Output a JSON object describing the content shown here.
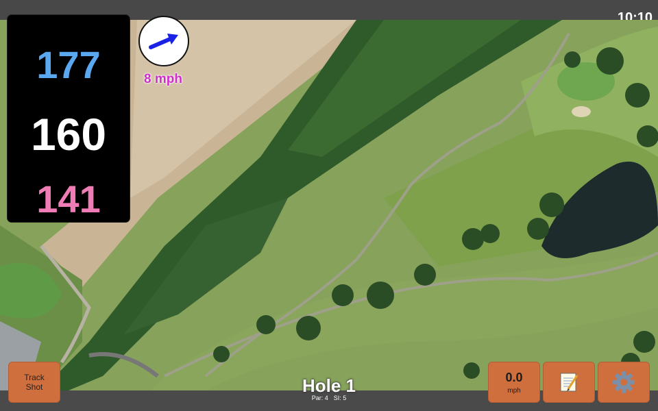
{
  "status_bar": {
    "time": "10:10"
  },
  "distances": {
    "back": "177",
    "center": "160",
    "front": "141",
    "colors": {
      "back": "#5aa8f0",
      "center": "#ffffff",
      "front": "#f07cb6"
    }
  },
  "wind": {
    "speed_label": "8 mph",
    "arrow_icon": "wind-direction-arrow"
  },
  "hole": {
    "title": "Hole 1",
    "par_label": "Par: 4",
    "si_label": "SI: 5"
  },
  "buttons": {
    "track_shot": "Track\nShot",
    "speed_value": "0.0",
    "speed_unit": "mph",
    "notes_icon": "notepad-icon",
    "settings_icon": "gear-icon"
  },
  "colors": {
    "button": "#cf6f3d",
    "bar": "#4a4a4a"
  }
}
